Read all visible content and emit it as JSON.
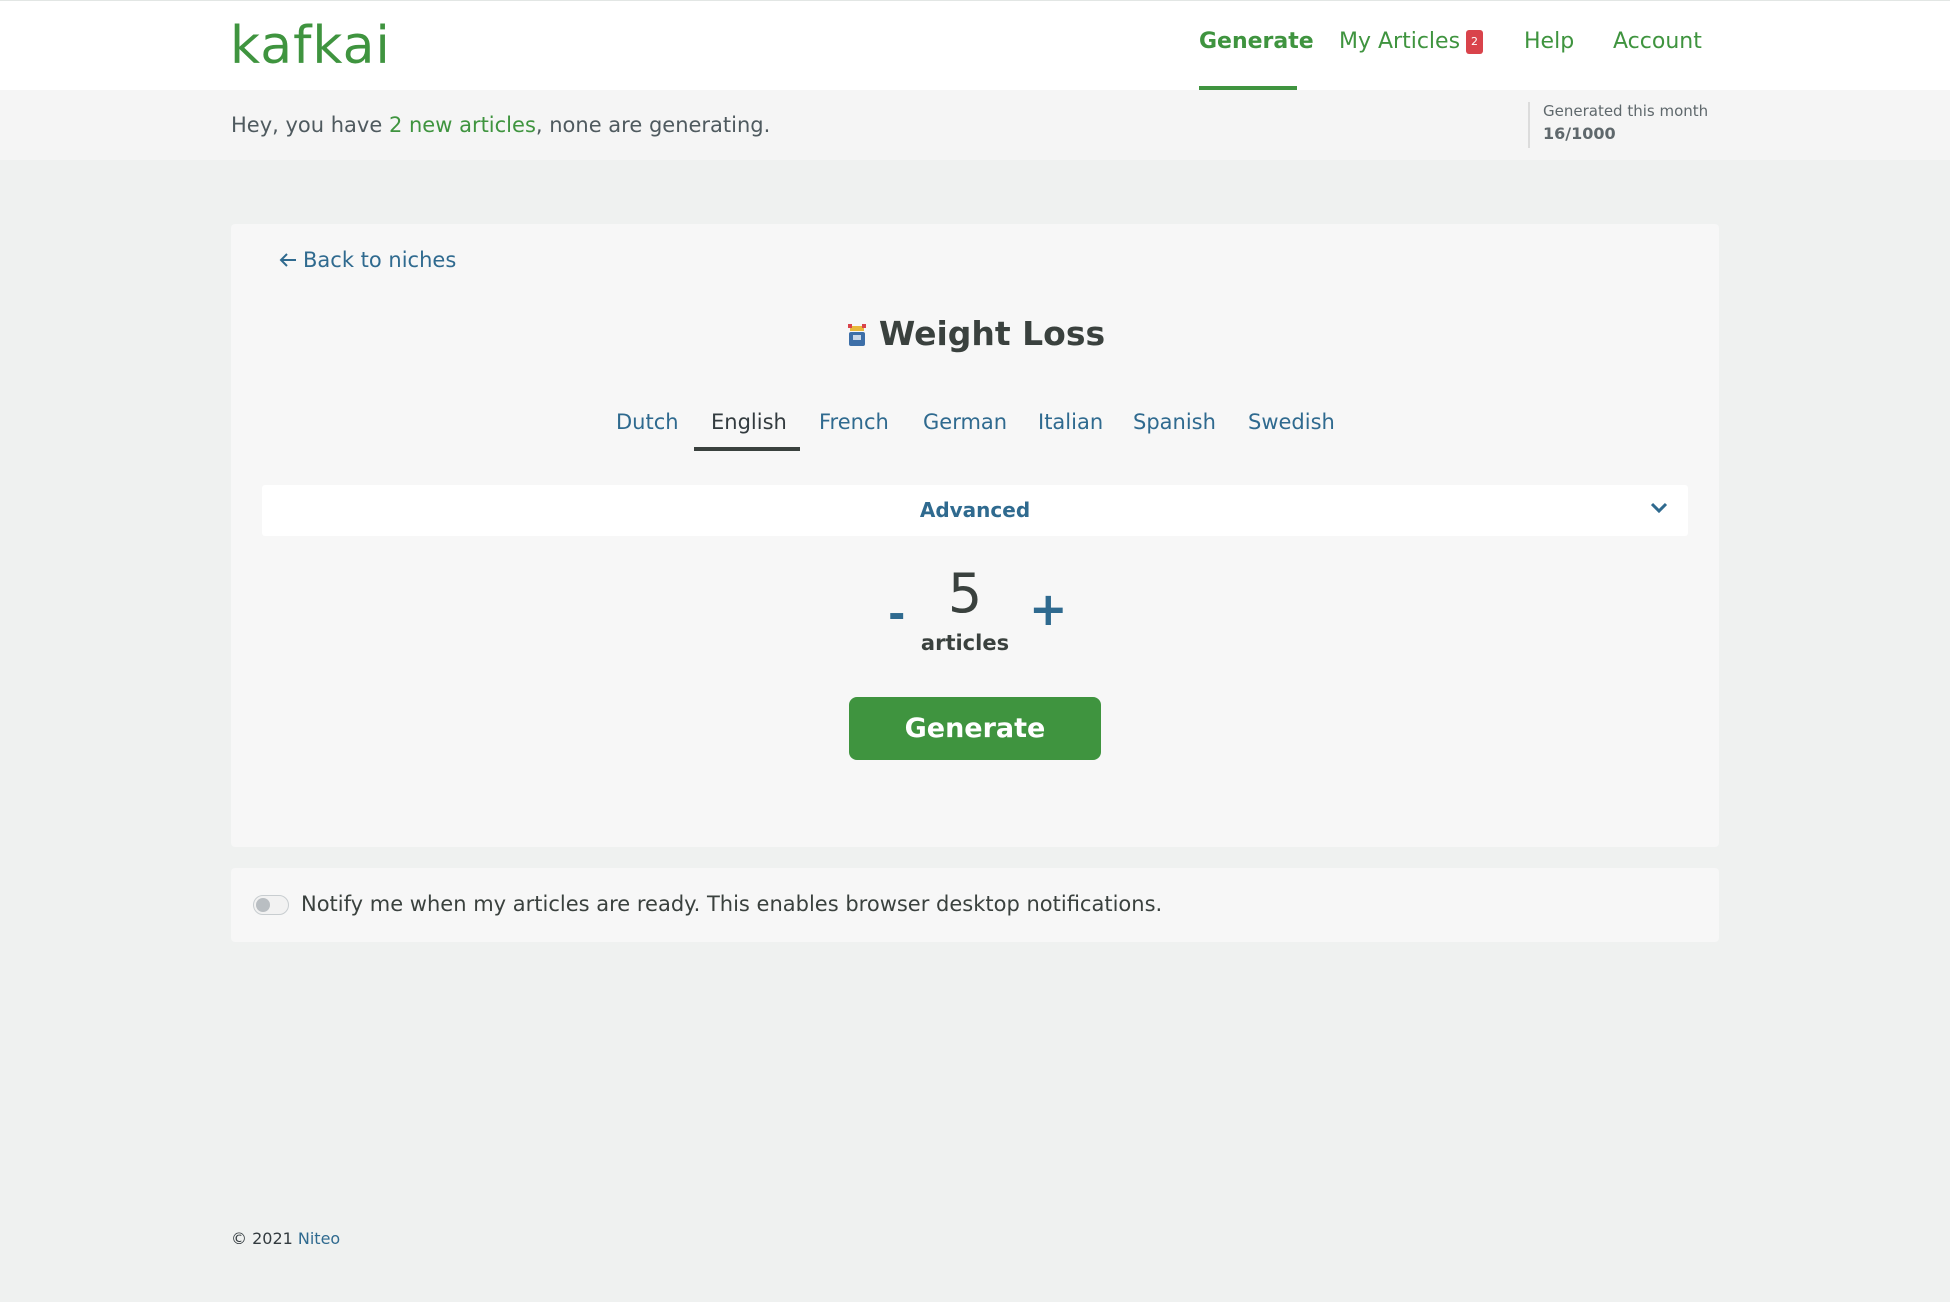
{
  "header": {
    "logo": "kafkai",
    "nav": [
      {
        "label": "Generate",
        "active": true
      },
      {
        "label": "My Articles",
        "badge": "2"
      },
      {
        "label": "Help"
      },
      {
        "label": "Account"
      }
    ],
    "accent_color": "#3f943f"
  },
  "infobar": {
    "greeting_prefix": "Hey, you have ",
    "greeting_link": "2 new articles",
    "greeting_suffix": ", none are generating.",
    "usage_label": "Generated this month",
    "usage_value": "16/1000"
  },
  "generator": {
    "back_link": "Back to niches",
    "back_icon": "arrow-left-icon",
    "niche_icon": "scale-icon",
    "niche_title": "Weight Loss",
    "languages": [
      {
        "label": "Dutch"
      },
      {
        "label": "English",
        "active": true
      },
      {
        "label": "French"
      },
      {
        "label": "German"
      },
      {
        "label": "Italian"
      },
      {
        "label": "Spanish"
      },
      {
        "label": "Swedish"
      }
    ],
    "advanced_label": "Advanced",
    "count_minus": "-",
    "count_value": "5",
    "count_plus": "+",
    "count_unit": "articles",
    "generate_label": "Generate"
  },
  "notify": {
    "enabled": false,
    "text": "Notify me when my articles are ready. This enables browser desktop notifications."
  },
  "footer": {
    "copyright": "© 2021 ",
    "company_link": "Niteo"
  }
}
